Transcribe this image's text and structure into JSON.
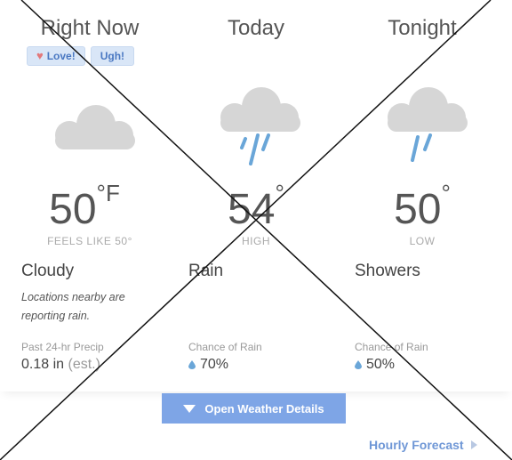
{
  "columns": [
    {
      "title": "Right Now",
      "temp": "50",
      "unit": "°F",
      "temp_label": "FEELS LIKE 50°",
      "condition": "Cloudy",
      "icon": "cloud-icon",
      "note": "Locations nearby are reporting rain.",
      "stat_label": "Past 24-hr Precip",
      "stat_value": "0.18 in",
      "stat_suffix": "(est.)"
    },
    {
      "title": "Today",
      "temp": "54",
      "unit": "°",
      "temp_label": "HIGH",
      "condition": "Rain",
      "icon": "rain-icon",
      "stat_label": "Chance of Rain",
      "stat_value": "70%"
    },
    {
      "title": "Tonight",
      "temp": "50",
      "unit": "°",
      "temp_label": "LOW",
      "condition": "Showers",
      "icon": "rain-icon",
      "stat_label": "Chance of Rain",
      "stat_value": "50%"
    }
  ],
  "reactions": {
    "love": "Love!",
    "ugh": "Ugh!"
  },
  "open_details": "Open Weather Details",
  "hourly": "Hourly Forecast",
  "colors": {
    "accent": "#7ea5e6",
    "link": "#6f97d6",
    "drop": "#6aa6d8",
    "cloud": "#d6d6d6"
  }
}
